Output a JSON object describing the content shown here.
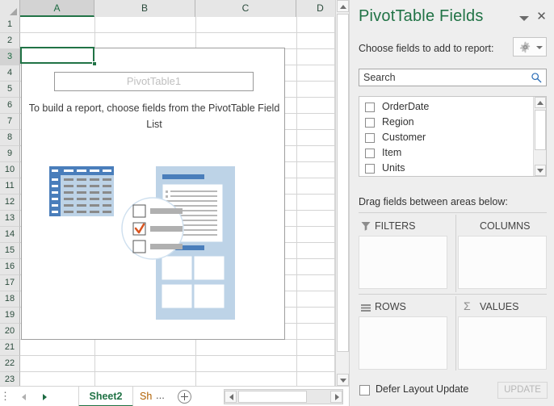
{
  "sheet": {
    "columns": [
      "A",
      "B",
      "C",
      "D"
    ],
    "selected_column": "A",
    "rows": [
      "1",
      "2",
      "3",
      "4",
      "5",
      "6",
      "7",
      "8",
      "9",
      "10",
      "11",
      "12",
      "13",
      "14",
      "15",
      "16",
      "17",
      "18",
      "19",
      "20",
      "21",
      "22",
      "23"
    ],
    "selected_row": "3",
    "selected_cell": "A3",
    "pivot_placeholder": {
      "name": "PivotTable1",
      "hint": "To build a report, choose fields from the PivotTable Field List"
    },
    "tabs": {
      "prev_icon": "nav-prev-icon",
      "next_icon": "nav-next-icon",
      "active_tab": "Sheet2",
      "clipped_tab": "Sh",
      "overflow_ellipsis": "...",
      "add_sheet_icon": "plus-circle-icon",
      "tab_menu_icon": "vertical-dots-icon"
    }
  },
  "pane": {
    "title": "PivotTable Fields",
    "collapse_icon": "chevron-down-icon",
    "close_icon": "close-icon",
    "choose_label": "Choose fields to add to report:",
    "tools_icon": "gear-icon",
    "tools_caret_icon": "caret-down-icon",
    "search": {
      "value": "Search",
      "placeholder": "Search",
      "icon": "search-icon"
    },
    "fields": [
      {
        "label": "OrderDate",
        "checked": false
      },
      {
        "label": "Region",
        "checked": false
      },
      {
        "label": "Customer",
        "checked": false
      },
      {
        "label": "Item",
        "checked": false
      },
      {
        "label": "Units",
        "checked": false
      }
    ],
    "drag_label": "Drag fields between areas below:",
    "areas": [
      {
        "label": "FILTERS",
        "icon": "funnel-icon",
        "items": []
      },
      {
        "label": "COLUMNS",
        "icon": "columns-icon",
        "items": []
      },
      {
        "label": "ROWS",
        "icon": "rows-icon",
        "items": []
      },
      {
        "label": "VALUES",
        "icon": "sigma-icon",
        "items": []
      }
    ],
    "defer_label": "Defer Layout Update",
    "update_label": "UPDATE"
  },
  "colors": {
    "excel_green": "#217346",
    "pane_bg": "#eeeeee",
    "header_bg": "#e6e6e6",
    "illustration_blue": "#4a7ebb",
    "illustration_light": "#bdd3e7",
    "check_orange": "#d9541f"
  }
}
